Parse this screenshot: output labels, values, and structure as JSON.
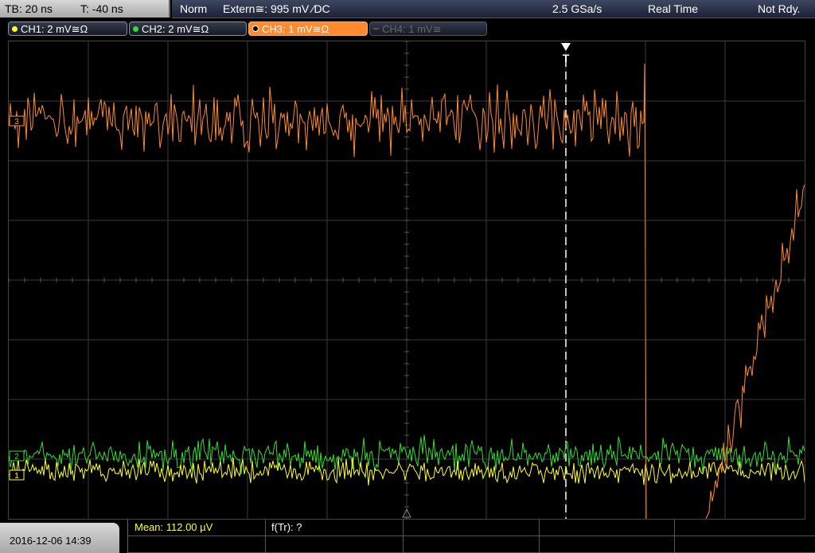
{
  "status_bar": {
    "timebase": "TB: 20 ns",
    "trigger_time": "T: -40 ns",
    "mode": "Norm",
    "trigger_source": "Extern≅: 995 mV ⁄DC",
    "sample_rate": "2.5 GSa/s",
    "acquire_mode": "Real Time",
    "trigger_state": "Not Rdy."
  },
  "channels": [
    {
      "label": "CH1: 2 mV≅Ω",
      "color": "#ffff33",
      "state": "on"
    },
    {
      "label": "CH2: 2 mV≅Ω",
      "color": "#33dd33",
      "state": "on"
    },
    {
      "label": "CH3: 1 mV≅Ω",
      "color": "#ff8a30",
      "state": "selected"
    },
    {
      "label": "CH4: 1 mV≅",
      "color": "#777777",
      "state": "off"
    }
  ],
  "markers": {
    "ch1": "1",
    "ch2": "2",
    "ch3": "3",
    "trigger": "T"
  },
  "colors": {
    "ch1": "#ffff33",
    "ch2": "#33dd33",
    "ch3": "#ff8a30",
    "grid": "#3a3a3a"
  },
  "footer": {
    "datetime": "2016-12-06 14:39",
    "meas1": "Mean: 112.00 µV",
    "meas2": "f(Tr): ?"
  }
}
